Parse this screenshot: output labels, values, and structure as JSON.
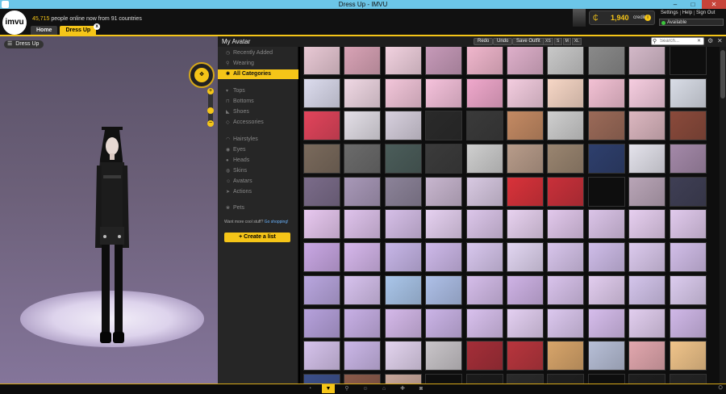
{
  "window": {
    "title": "Dress Up - IMVU",
    "min": "–",
    "max": "□",
    "close": "✕"
  },
  "header": {
    "logo": "imvu",
    "online_count": "45,715",
    "online_text": " people online now from 91 countries",
    "tabs": [
      {
        "label": "Home"
      },
      {
        "label": "Dress Up"
      }
    ],
    "tab_close": "x",
    "credits": {
      "amount": "1,940",
      "label": "credits",
      "coin": "₵",
      "info": "i"
    },
    "links": [
      "Settings",
      "Help",
      "Sign Out"
    ],
    "status": "Available"
  },
  "viewport": {
    "label": "Dress Up",
    "accent": "#f5c518"
  },
  "panel": {
    "title": "My Avatar",
    "buttons": {
      "redo": "Redo",
      "undo": "Undo",
      "save": "Save Outfit"
    },
    "sizes": [
      "XS",
      "S",
      "M",
      "XL"
    ],
    "search_placeholder": "Search..."
  },
  "sidebar": {
    "group1": [
      {
        "label": "Recently Added"
      },
      {
        "label": "Wearing"
      },
      {
        "label": "All Categories",
        "active": true
      }
    ],
    "group2": [
      {
        "label": "Tops"
      },
      {
        "label": "Bottoms"
      },
      {
        "label": "Shoes"
      },
      {
        "label": "Accessories"
      }
    ],
    "group3": [
      {
        "label": "Hairstyles"
      },
      {
        "label": "Eyes"
      },
      {
        "label": "Heads"
      },
      {
        "label": "Skins"
      },
      {
        "label": "Avatars"
      },
      {
        "label": "Actions"
      }
    ],
    "group4": [
      {
        "label": "Pets"
      }
    ],
    "more_text": "Want more cool stuff?",
    "more_link": "Go shopping!",
    "create_label": "Create a list"
  },
  "grid": {
    "rows": [
      [
        "#e9c9d5",
        "#d9a3b6",
        "#f2d2e0",
        "#c79ab9",
        "#f1b7cd",
        "#dfb0cb",
        "#c9c9c9",
        "#8a8a8a",
        "#d4b9c9",
        "#444"
      ],
      [
        "#dcdcee",
        "#f0d8e4",
        "#f3c6da",
        "#f6c2dc",
        "#f0a8cc",
        "#f4cde0",
        "#f7d7c6",
        "#f3c1d4",
        "#f6cde0",
        "#d9dde7"
      ],
      [
        "#e2445b",
        "#e3dfe7",
        "#d7d0de",
        "#2a2a2a",
        "#3a3a3a",
        "#c48a63",
        "#cfcfcf",
        "#9b6a58",
        "#dcb7c0",
        "#8a4a3b"
      ],
      [
        "#7a6a5c",
        "#6b6b6b",
        "#4b5d5a",
        "#3b3b3b",
        "#cfcfcf",
        "#b89c8a",
        "#9a8570",
        "#2e3f6d",
        "#e4e3ec",
        "#a489a9"
      ],
      [
        "#7b6c8a",
        "#a898b8",
        "#8c8399",
        "#c8b6cf",
        "#d8c9e2",
        "#d9323a",
        "#c9303a",
        "#333",
        "#b9a5b7",
        "#3f3f55"
      ],
      [
        "#e8c8f0",
        "#dfc3ec",
        "#d6bfe8",
        "#e6d1f1",
        "#dcc6ea",
        "#e8d2f0",
        "#e2c8ec",
        "#dbc4e8",
        "#e7cff0",
        "#e1caed"
      ],
      [
        "#c9a7e4",
        "#d6b7ec",
        "#c7b6e8",
        "#ceb9ea",
        "#d8c7ee",
        "#e2d6f2",
        "#d8c5ec",
        "#cfbde9",
        "#dccaee",
        "#d2bee9"
      ],
      [
        "#b9a6df",
        "#d7c2ee",
        "#aac6ea",
        "#aec0e8",
        "#d5bdea",
        "#cfb3e6",
        "#d9c3ec",
        "#e2cdef",
        "#d4c5ec",
        "#dcccef"
      ],
      [
        "#b6a1dc",
        "#c8b0e6",
        "#d5b9ea",
        "#cbb4e7",
        "#d9c1ee",
        "#e4d0f2",
        "#dcc8ef",
        "#d6bdec",
        "#e2ceef",
        "#d0b8e8"
      ],
      [
        "#d6c3ec",
        "#cbb7e8",
        "#e3d4ef",
        "#c9c5c9",
        "#a52e38",
        "#b8353d",
        "#d8a56a",
        "#b7bfd7",
        "#e2a7ae",
        "#f0c48a"
      ],
      [
        "#3b4f8a",
        "#8a5a4a",
        "#c7a69a",
        "#bbb",
        "#1a1a1a",
        "#2a2a2a",
        "#1f1f1f",
        "#222",
        "#1e1e1e",
        "#232323"
      ]
    ]
  },
  "bottom_icons": [
    "chat-bubble-icon",
    "shirt-icon",
    "hanger-icon",
    "user-icon",
    "home-icon",
    "puzzle-icon",
    "camera-icon"
  ],
  "bottom_right": "⛭"
}
